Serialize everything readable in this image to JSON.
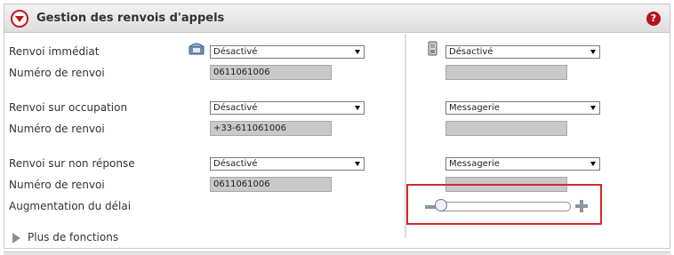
{
  "panel": {
    "title": "Gestion des renvois d'appels",
    "toggle_icon": "chevron-down-icon",
    "help_label": "?"
  },
  "rows": {
    "immediate": {
      "label": "Renvoi immédiat",
      "number_label": "Numéro de renvoi",
      "fixed_select": "Désactivé",
      "fixed_number": "0611061006",
      "mobile_select": "Désactivé",
      "mobile_number": ""
    },
    "busy": {
      "label": "Renvoi sur occupation",
      "number_label": "Numéro de renvoi",
      "fixed_select": "Désactivé",
      "fixed_number": "+33-611061006",
      "mobile_select": "Messagerie",
      "mobile_number": ""
    },
    "no_answer": {
      "label": "Renvoi sur non réponse",
      "number_label": "Numéro de renvoi",
      "fixed_select": "Désactivé",
      "fixed_number": "0611061006",
      "mobile_select": "Messagerie",
      "mobile_number": ""
    }
  },
  "delay": {
    "label": "Augmentation du délai",
    "slider_level": 0.0
  },
  "more_functions": "Plus de fonctions",
  "colors": {
    "accent_red": "#c0181c",
    "highlight_border": "#d42a2a",
    "field_gray": "#c9c9c9"
  }
}
